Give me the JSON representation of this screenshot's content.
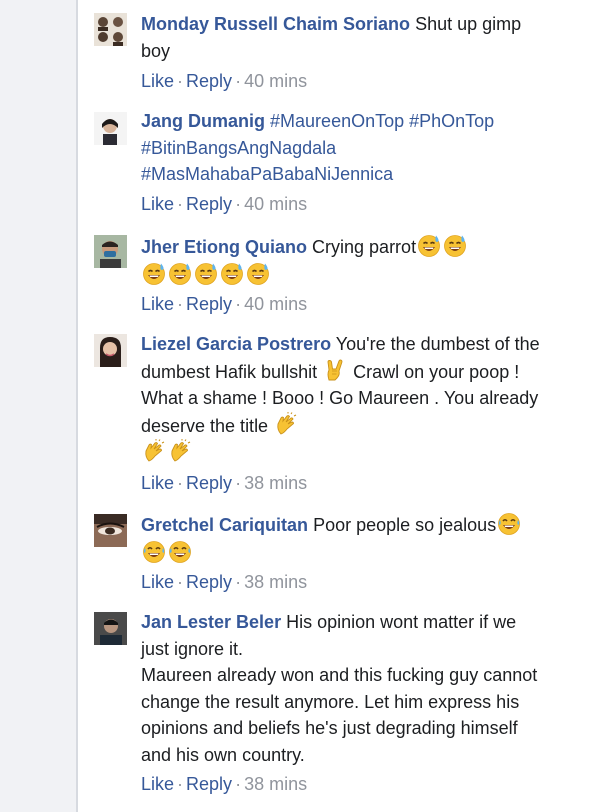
{
  "actions": {
    "like": "Like",
    "reply": "Reply",
    "sep": "·"
  },
  "comments": [
    {
      "name": "Monday Russell Chaim Soriano",
      "text": "Shut up gimp boy",
      "time": "40 mins"
    },
    {
      "name": "Jang Dumanig",
      "text": "#MaureenOnTop #PhOnTop #BitinBangsAngNagdala #MasMahabaPaBabaNiJennica",
      "time": "40 mins"
    },
    {
      "name": "Jher Etiong Quiano",
      "text": "Crying parrot",
      "emojis": "7 x grinning-sweat-emoji",
      "time": "40 mins"
    },
    {
      "name": "Liezel Garcia Postrero",
      "text": "You're the dumbest of the dumbest Hafik bullshit",
      "text2": "Crawl on your poop ! What a shame ! Booo ! Go Maureen . You already deserve the title",
      "emojis": "horns-hand-emoji, 3 x clapping-hands-emoji",
      "time": "38 mins"
    },
    {
      "name": "Gretchel Cariquitan",
      "text": "Poor people so jealous",
      "emojis": "3 x laughing-tears-emoji",
      "time": "38 mins"
    },
    {
      "name": "Jan Lester Beler",
      "text": "His opinion wont matter if we just ignore it.\nMaureen already won and this fucking guy cannot change the result anymore. Let him express his opinions and beliefs he's just degrading himself and his own country.",
      "time": "38 mins"
    }
  ],
  "colors": {
    "link": "#365899",
    "meta": "#90949c",
    "text": "#1c1e21",
    "gutter": "#f1f2f5"
  }
}
